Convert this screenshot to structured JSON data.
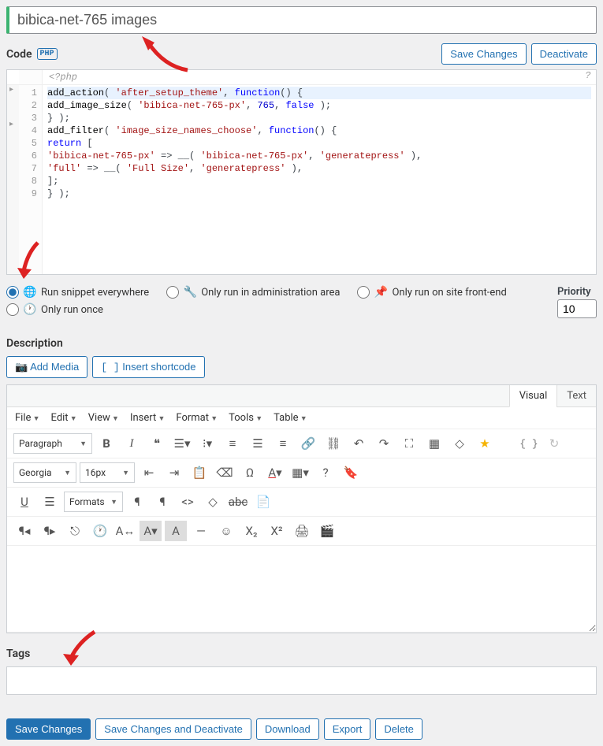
{
  "title_value": "bibica-net-765 images",
  "header": {
    "code_label": "Code",
    "php_tag": "PHP",
    "save_changes": "Save Changes",
    "deactivate": "Deactivate"
  },
  "code": {
    "opener": "<?php",
    "help": "?",
    "lines": [
      "1",
      "2",
      "3",
      "4",
      "5",
      "6",
      "7",
      "8",
      "9"
    ],
    "l1": {
      "fn": "add_action",
      "a": "( ",
      "s1": "'after_setup_theme'",
      "b": ", ",
      "kw": "function",
      "c": "() {"
    },
    "l2": {
      "fn": "add_image_size",
      "a": "( ",
      "s1": "'bibica-net-765-px'",
      "b": ", ",
      "n": "765",
      "c": ", ",
      "kw": "false",
      "d": " );"
    },
    "l3": {
      "t": "} );"
    },
    "l4": {
      "fn": "add_filter",
      "a": "( ",
      "s1": "'image_size_names_choose'",
      "b": ", ",
      "kw": "function",
      "c": "() {"
    },
    "l5": {
      "kw": "return",
      "t": " ["
    },
    "l6": {
      "s1": "'bibica-net-765-px'",
      "a": " => __( ",
      "s2": "'bibica-net-765-px'",
      "b": ", ",
      "s3": "'generatepress'",
      "c": " ),"
    },
    "l7": {
      "s1": "'full'",
      "a": " => __( ",
      "s2": "'Full Size'",
      "b": ", ",
      "s3": "'generatepress'",
      "c": " ),"
    },
    "l8": {
      "t": "];"
    },
    "l9": {
      "t": "} );"
    }
  },
  "run": {
    "everywhere": "Run snippet everywhere",
    "admin": "Only run in administration area",
    "frontend": "Only run on site front-end",
    "once": "Only run once",
    "priority_label": "Priority",
    "priority_value": "10"
  },
  "description": {
    "heading": "Description",
    "add_media": "Add Media",
    "insert_shortcode": "Insert shortcode",
    "visual": "Visual",
    "text": "Text",
    "menu": {
      "file": "File",
      "edit": "Edit",
      "view": "View",
      "insert": "Insert",
      "format": "Format",
      "tools": "Tools",
      "table": "Table"
    },
    "paragraph": "Paragraph",
    "font": "Georgia",
    "size": "16px",
    "formats": "Formats",
    "curly": "{ }"
  },
  "tags": {
    "heading": "Tags"
  },
  "bottom": {
    "save": "Save Changes",
    "save_deactivate": "Save Changes and Deactivate",
    "download": "Download",
    "export": "Export",
    "delete": "Delete"
  }
}
